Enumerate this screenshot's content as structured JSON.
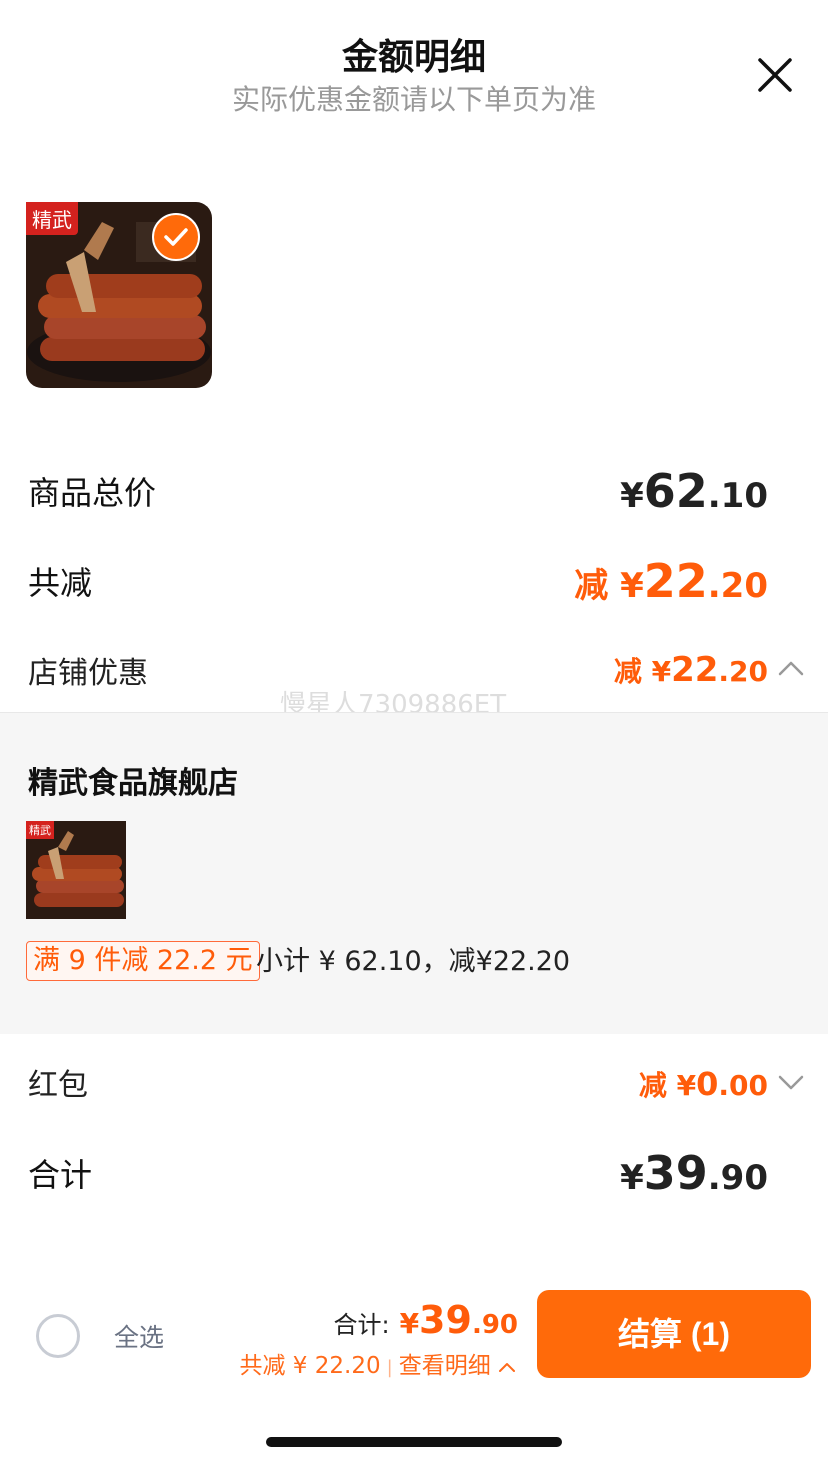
{
  "header": {
    "title": "金额明细",
    "subtitle": "实际优惠金额请以下单页为准"
  },
  "product": {
    "brand_tag": "精武",
    "selected": true
  },
  "summary": {
    "goods_total_label": "商品总价",
    "goods_total_yen": "¥",
    "goods_total_int": "62",
    "goods_total_dec": ".10",
    "total_discount_label": "共减",
    "total_discount_prefix": "减 ¥",
    "total_discount_int": "22",
    "total_discount_dec": ".20",
    "store_discount_label": "店铺优惠",
    "store_discount_prefix": "减 ¥",
    "store_discount_int": "22",
    "store_discount_dec": ".20",
    "red_packet_label": "红包",
    "red_packet_prefix": "减 ¥",
    "red_packet_int": "0",
    "red_packet_dec": ".00",
    "grand_total_label": "合计",
    "grand_total_yen": "¥",
    "grand_total_int": "39",
    "grand_total_dec": ".90"
  },
  "store_panel": {
    "store_name": "精武食品旗舰店",
    "brand_tag": "精武",
    "promo_tag": "满 9 件减 22.2 元",
    "subtotal_text": "小计 ¥ 62.10，减¥22.20"
  },
  "watermark": "慢星人7309886ET",
  "bottom_bar": {
    "select_all_label": "全选",
    "total_label": "合计:",
    "total_yen": "¥",
    "total_int": "39",
    "total_dec": ".90",
    "discount_text": "共减 ¥ 22.20",
    "separator": "|",
    "detail_link": "查看明细",
    "checkout_label": "结算 (1)"
  },
  "colors": {
    "accent": "#ff5c0a",
    "button": "#ff6a0a",
    "brand_red": "#d4221e"
  },
  "icons": {
    "close": "close-icon",
    "check": "check-icon",
    "chevron_up": "chevron-up-icon",
    "chevron_down": "chevron-down-icon"
  }
}
